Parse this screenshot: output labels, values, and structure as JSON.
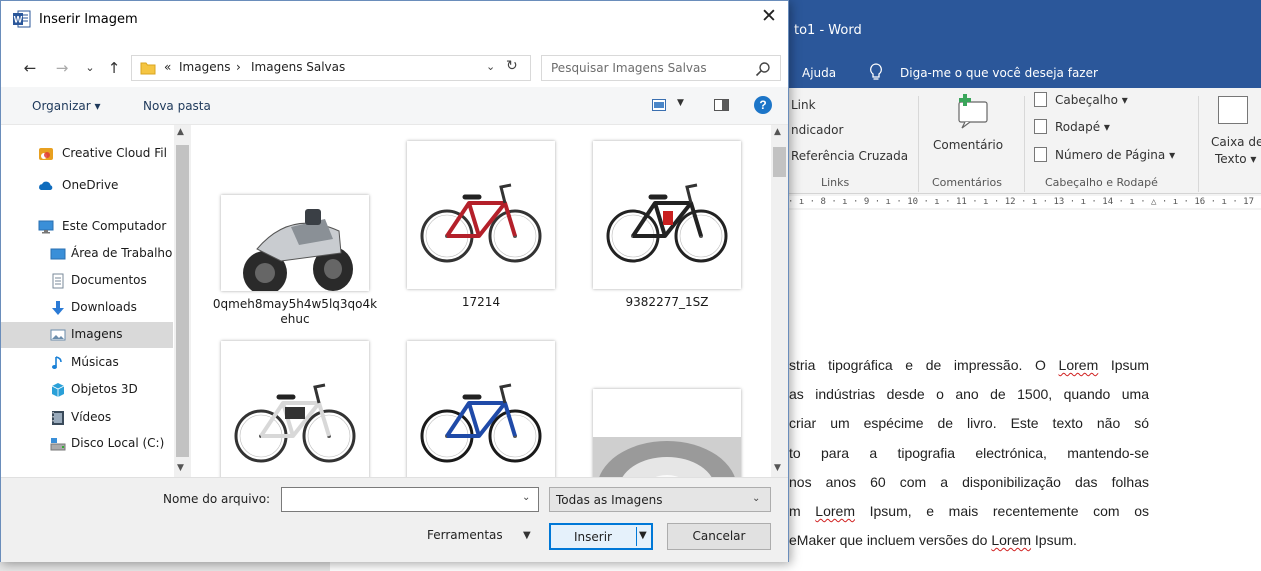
{
  "word": {
    "title": "to1  -  Word",
    "menu": {
      "help": "Ajuda",
      "tell_me": "Diga-me o que você deseja fazer"
    },
    "ribbon": {
      "links": [
        "Link",
        "ndicador",
        "Referência Cruzada"
      ],
      "links_group": "Links",
      "comment_label": "Comentário",
      "comments_group": "Comentários",
      "header": "Cabeçalho ▾",
      "footer": "Rodapé ▾",
      "page_number": "Número de Página ▾",
      "header_footer_group": "Cabeçalho e Rodapé",
      "textbox_line1": "Caixa de",
      "textbox_line2": "Texto ▾"
    },
    "ruler": "· ı · 8 · ı · 9 · ı · 10 · ı · 11 · ı · 12 · ı · 13 · ı · 14 · ı · △ · ı · 16 · ı · 17 · ı ·",
    "body_lines": [
      {
        "pre": "stria tipográfica e de impressão. O ",
        "mark": "Lorem",
        "post": " Ipsum"
      },
      {
        "pre": "as indústrias desde o ano de 1500, quando uma",
        "mark": "",
        "post": ""
      },
      {
        "pre": "criar um espécime de livro. Este texto não só",
        "mark": "",
        "post": ""
      },
      {
        "pre": "to para a tipografia electrónica, mantendo-se",
        "mark": "",
        "post": ""
      },
      {
        "pre": " nos anos 60 com a disponibilização das folhas",
        "mark": "",
        "post": ""
      },
      {
        "pre": "m ",
        "mark": "Lorem",
        "post": " Ipsum, e mais recentemente com os"
      },
      {
        "pre": "eMaker que incluem versões do ",
        "mark": "Lorem",
        "post": " Ipsum."
      }
    ]
  },
  "dialog": {
    "title": "Inserir Imagem",
    "close": "✕",
    "nav": {
      "back": "←",
      "forward": "→",
      "recent": "⌄",
      "up": "↑"
    },
    "breadcrumb": {
      "prefix": "«",
      "items": [
        "Imagens",
        "Imagens Salvas"
      ],
      "sep": "›"
    },
    "search_placeholder": "Pesquisar Imagens Salvas",
    "toolbar": {
      "organize": "Organizar ▾",
      "new_folder": "Nova pasta",
      "help": "?"
    },
    "sidebar": [
      {
        "label": "Creative Cloud Fil",
        "icon": "creative-cloud-icon",
        "color": "#e8a020"
      },
      {
        "label": "OneDrive",
        "icon": "onedrive-icon",
        "color": "#0f6cbd"
      },
      {
        "label": "Este Computador",
        "icon": "computer-icon",
        "color": "#3a8fd8"
      },
      {
        "label": "Área de Trabalho",
        "icon": "desktop-icon",
        "color": "#3a8fd8"
      },
      {
        "label": "Documentos",
        "icon": "documents-icon",
        "color": "#7a8a99"
      },
      {
        "label": "Downloads",
        "icon": "downloads-icon",
        "color": "#2b7bd6"
      },
      {
        "label": "Imagens",
        "icon": "pictures-icon",
        "color": "#6a8cab"
      },
      {
        "label": "Músicas",
        "icon": "music-icon",
        "color": "#1a80d6"
      },
      {
        "label": "Objetos 3D",
        "icon": "objects-3d-icon",
        "color": "#2aa0d8"
      },
      {
        "label": "Vídeos",
        "icon": "videos-icon",
        "color": "#3a4a5a"
      },
      {
        "label": "Disco Local (C:)",
        "icon": "local-disk-icon",
        "color": "#3a8fd8"
      }
    ],
    "files": [
      {
        "name": "0qmeh8may5h4w5lq3qo4kehuc",
        "kind": "motorbike"
      },
      {
        "name": "17214",
        "kind": "red-bike"
      },
      {
        "name": "9382277_1SZ",
        "kind": "black-bike"
      },
      {
        "name": "",
        "kind": "white-ebike"
      },
      {
        "name": "",
        "kind": "blue-bike"
      },
      {
        "name": "",
        "kind": "tunnel"
      }
    ],
    "filename_label": "Nome do arquivo:",
    "filename_value": "",
    "filter": "Todas as Imagens",
    "tools": "Ferramentas",
    "insert": "Inserir",
    "cancel": "Cancelar"
  }
}
